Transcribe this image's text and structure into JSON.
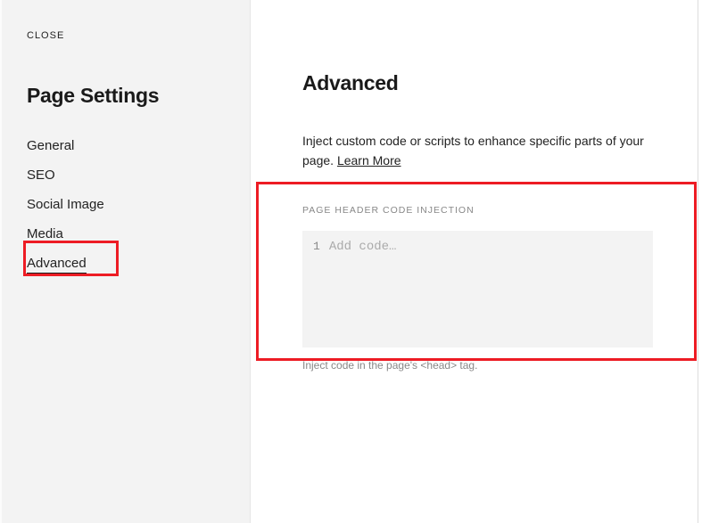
{
  "close_label": "CLOSE",
  "sidebar": {
    "title": "Page Settings",
    "items": [
      {
        "label": "General"
      },
      {
        "label": "SEO"
      },
      {
        "label": "Social Image"
      },
      {
        "label": "Media"
      },
      {
        "label": "Advanced"
      }
    ]
  },
  "main": {
    "title": "Advanced",
    "description_prefix": "Inject custom code or scripts to enhance specific parts of your page. ",
    "learn_more": "Learn More",
    "section_label": "PAGE HEADER CODE INJECTION",
    "code_line_number": "1",
    "code_placeholder": "Add code…",
    "helper_text": "Inject code in the page's <head> tag."
  }
}
